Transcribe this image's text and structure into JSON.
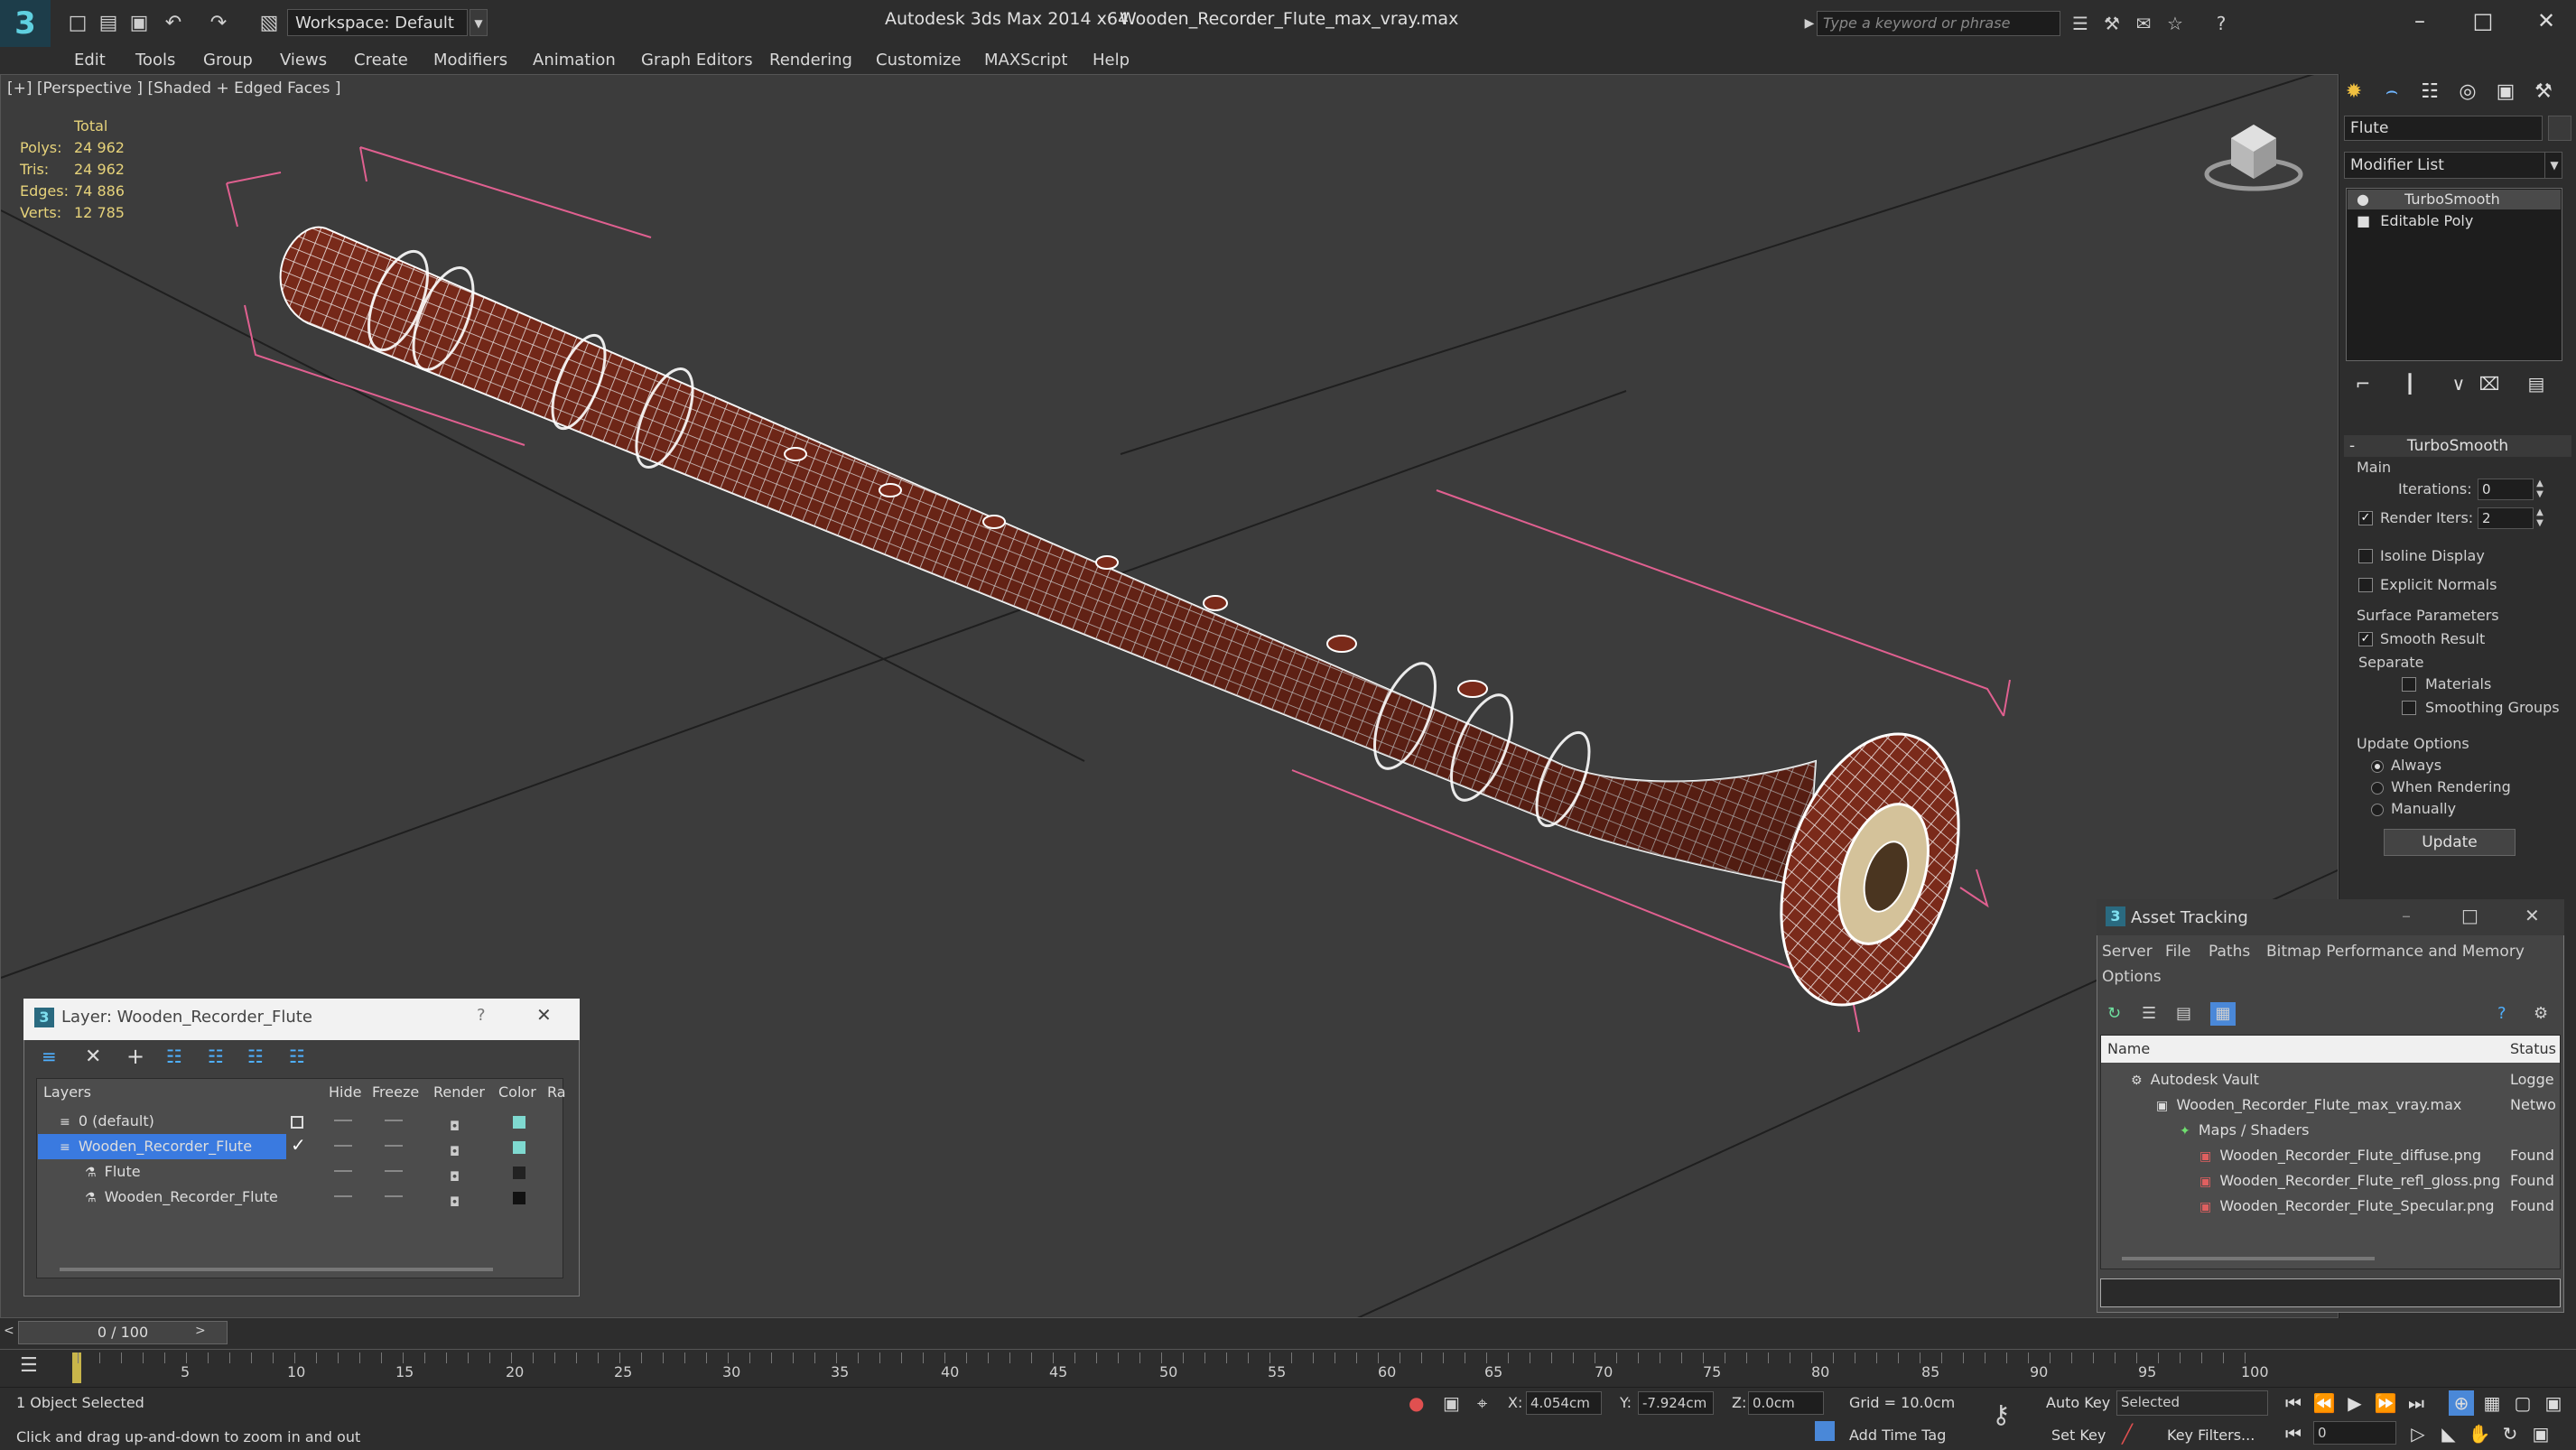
{
  "titlebar": {
    "workspace_label": "Workspace: Default",
    "app_title": "Autodesk 3ds Max  2014 x64",
    "file_title": "Wooden_Recorder_Flute_max_vray.max",
    "search_placeholder": "Type a keyword or phrase"
  },
  "menus": [
    "Edit",
    "Tools",
    "Group",
    "Views",
    "Create",
    "Modifiers",
    "Animation",
    "Graph Editors",
    "Rendering",
    "Customize",
    "MAXScript",
    "Help"
  ],
  "viewport": {
    "label": "[+] [Perspective ] [Shaded + Edged Faces ]",
    "stats_header": "Total",
    "stats": [
      {
        "label": "Polys:",
        "value": "24 962"
      },
      {
        "label": "Tris:",
        "value": "24 962"
      },
      {
        "label": "Edges:",
        "value": "74 886"
      },
      {
        "label": "Verts:",
        "value": "12 785"
      }
    ],
    "wire_color": "#ffffff",
    "object_color": "#7a2a1a",
    "bbox_color": "#e06090"
  },
  "command_panel": {
    "object_name": "Flute",
    "modifier_list": "Modifier List",
    "stack": [
      "TurboSmooth",
      "Editable Poly"
    ],
    "rollout_title": "TurboSmooth",
    "main_group": "Main",
    "iterations_label": "Iterations:",
    "iterations_value": "0",
    "render_iters_label": "Render Iters:",
    "render_iters_value": "2",
    "isoline_display": "Isoline Display",
    "explicit_normals": "Explicit Normals",
    "surface_params": "Surface Parameters",
    "smooth_result": "Smooth Result",
    "separate": "Separate",
    "materials": "Materials",
    "smoothing_groups": "Smoothing Groups",
    "update_options": "Update Options",
    "always": "Always",
    "when_rendering": "When Rendering",
    "manually": "Manually",
    "update_button": "Update"
  },
  "layer_window": {
    "title": "Layer: Wooden_Recorder_Flute",
    "help": "?",
    "columns": [
      "Layers",
      "Hide",
      "Freeze",
      "Render",
      "Color",
      "Ra"
    ],
    "rows": [
      {
        "name": "0 (default)",
        "color": "#7fd9d0"
      },
      {
        "name": "Wooden_Recorder_Flute",
        "color": "#7fd9d0"
      },
      {
        "name": "Flute",
        "color": "#222222"
      },
      {
        "name": "Wooden_Recorder_Flute",
        "color": "#111111"
      }
    ]
  },
  "asset_window": {
    "title": "Asset Tracking",
    "menu": [
      "Server",
      "File",
      "Paths",
      "Bitmap Performance and Memory",
      "Options"
    ],
    "columns": [
      "Name",
      "Status"
    ],
    "rows": [
      {
        "name": "Autodesk Vault",
        "status": "Logge"
      },
      {
        "name": "Wooden_Recorder_Flute_max_vray.max",
        "status": "Netwo"
      },
      {
        "name": "Maps / Shaders",
        "status": ""
      },
      {
        "name": "Wooden_Recorder_Flute_diffuse.png",
        "status": "Found"
      },
      {
        "name": "Wooden_Recorder_Flute_refl_gloss.png",
        "status": "Found"
      },
      {
        "name": "Wooden_Recorder_Flute_Specular.png",
        "status": "Found"
      }
    ]
  },
  "timeline": {
    "slider": "0 / 100",
    "ticks": [
      "5",
      "10",
      "15",
      "20",
      "25",
      "30",
      "35",
      "40",
      "45",
      "50",
      "55",
      "60",
      "65",
      "70",
      "75",
      "80",
      "85",
      "90",
      "95",
      "100"
    ]
  },
  "statusbar": {
    "selection": "1 Object Selected",
    "prompt": "Click and drag up-and-down to zoom in and out",
    "x_label": "X:",
    "x_value": "4.054cm",
    "y_label": "Y:",
    "y_value": "-7.924cm",
    "z_label": "Z:",
    "z_value": "0.0cm",
    "grid": "Grid = 10.0cm",
    "add_time_tag": "Add Time Tag",
    "auto_key": "Auto Key",
    "set_key": "Set Key",
    "selected": "Selected",
    "key_filters": "Key Filters...",
    "frame": "0"
  }
}
